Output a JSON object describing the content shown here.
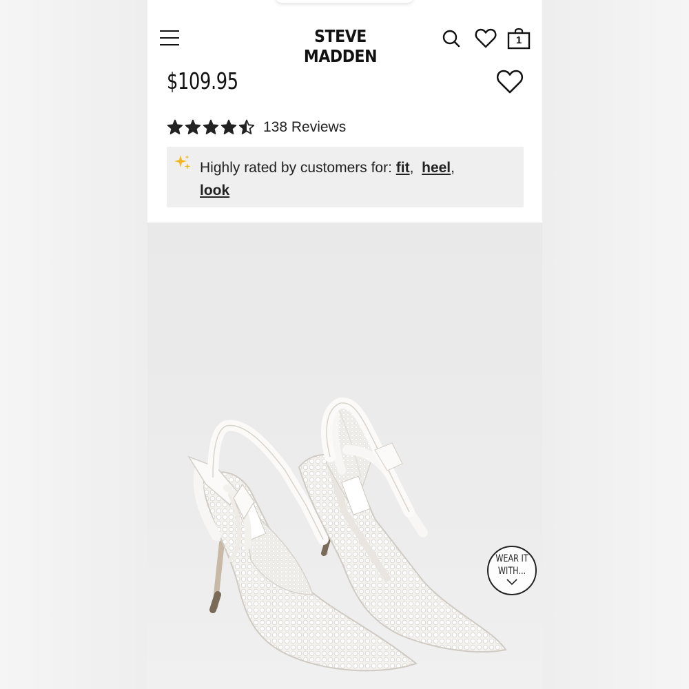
{
  "header": {
    "brand": "STEVE MADDEN",
    "bag_count": "1",
    "icons": [
      "menu-icon",
      "search-icon",
      "heart-icon",
      "shopping-bag-icon"
    ]
  },
  "product": {
    "price": "$109.95",
    "rating": 4.5,
    "rating_max": 5,
    "reviews_label": "138 Reviews",
    "highlight_prefix": "Highly rated by customers for:",
    "highlight_links": [
      {
        "label": "fit",
        "sep": ","
      },
      {
        "label": "heel",
        "sep": ","
      },
      {
        "label": "look",
        "sep": ""
      }
    ],
    "image_label": "STEVE MADDEN"
  },
  "wear_it": {
    "line1": "WEAR IT",
    "line2": "WITH..."
  },
  "colors": {
    "text": "#111111",
    "highlight_bg": "#efefef",
    "sparkle": "#f2b824",
    "page_bg": "#f3f3f3"
  }
}
